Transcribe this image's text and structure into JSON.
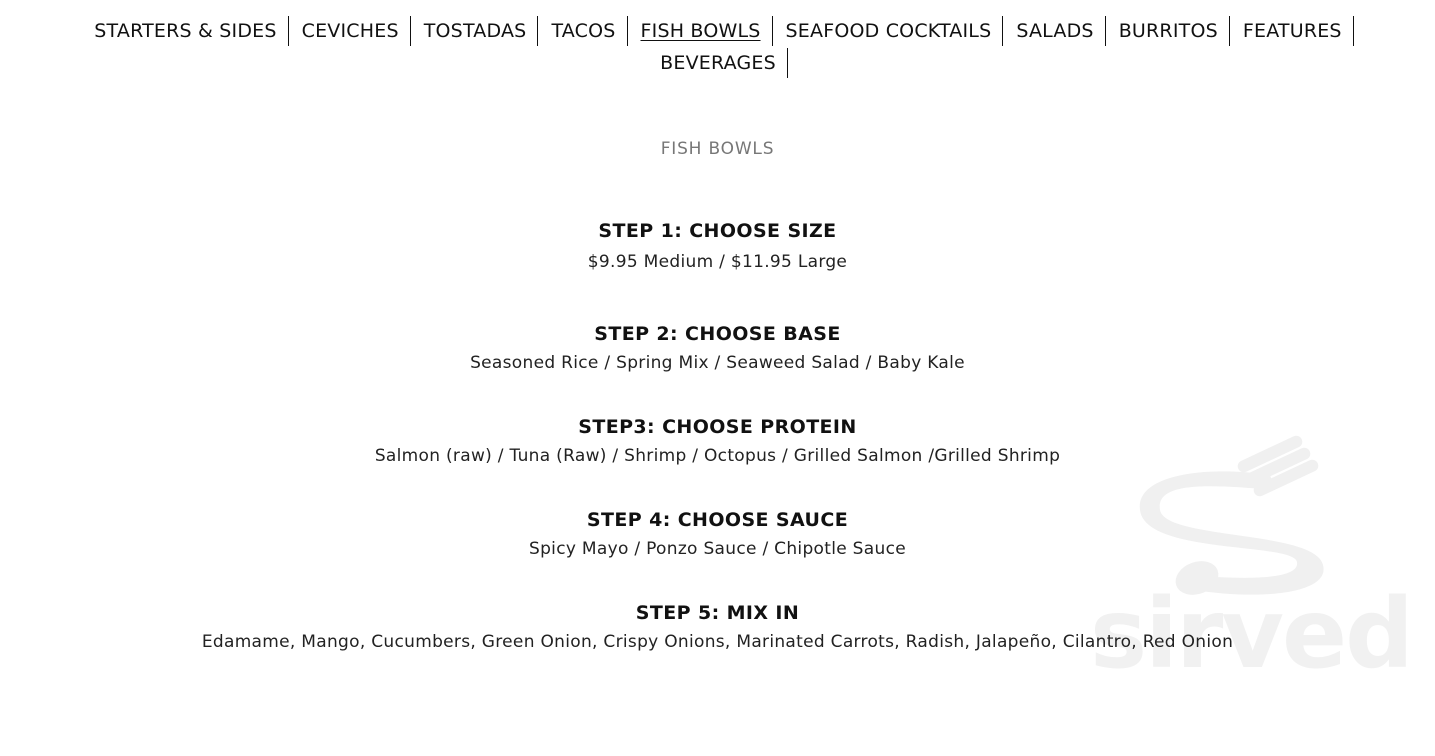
{
  "nav": {
    "row1": [
      {
        "label": "STARTERS & SIDES",
        "active": false
      },
      {
        "label": "CEVICHES",
        "active": false
      },
      {
        "label": "TOSTADAS",
        "active": false
      },
      {
        "label": "TACOS",
        "active": false
      },
      {
        "label": "FISH BOWLS",
        "active": true
      },
      {
        "label": "SEAFOOD COCKTAILS",
        "active": false
      },
      {
        "label": "SALADS",
        "active": false
      },
      {
        "label": "BURRITOS",
        "active": false
      },
      {
        "label": "FEATURES",
        "active": false
      }
    ],
    "row2": [
      {
        "label": "BEVERAGES",
        "active": false
      }
    ]
  },
  "section": {
    "title": "FISH BOWLS"
  },
  "steps": [
    {
      "title": "STEP 1: CHOOSE SIZE",
      "desc": "$9.95 Medium / $11.95 Large"
    },
    {
      "title": "STEP 2: CHOOSE BASE",
      "desc": "Seasoned Rice / Spring Mix / Seaweed Salad / Baby Kale"
    },
    {
      "title": "STEP3: CHOOSE PROTEIN",
      "desc": "Salmon (raw) / Tuna (Raw) / Shrimp / Octopus / Grilled Salmon /Grilled Shrimp"
    },
    {
      "title": "STEP 4: CHOOSE SAUCE",
      "desc": "Spicy Mayo / Ponzo Sauce / Chipotle Sauce"
    },
    {
      "title": "STEP 5: MIX IN",
      "desc": "Edamame, Mango, Cucumbers, Green Onion, Crispy Onions, Marinated Carrots, Radish, Jalapeño, Cilantro, Red Onion"
    }
  ],
  "watermark": {
    "text": "sirved",
    "icon": "fork-spoon-logo-icon",
    "color": "#eeeeee"
  },
  "colors": {
    "text": "#111111",
    "section_title": "#777777",
    "background": "#ffffff"
  }
}
